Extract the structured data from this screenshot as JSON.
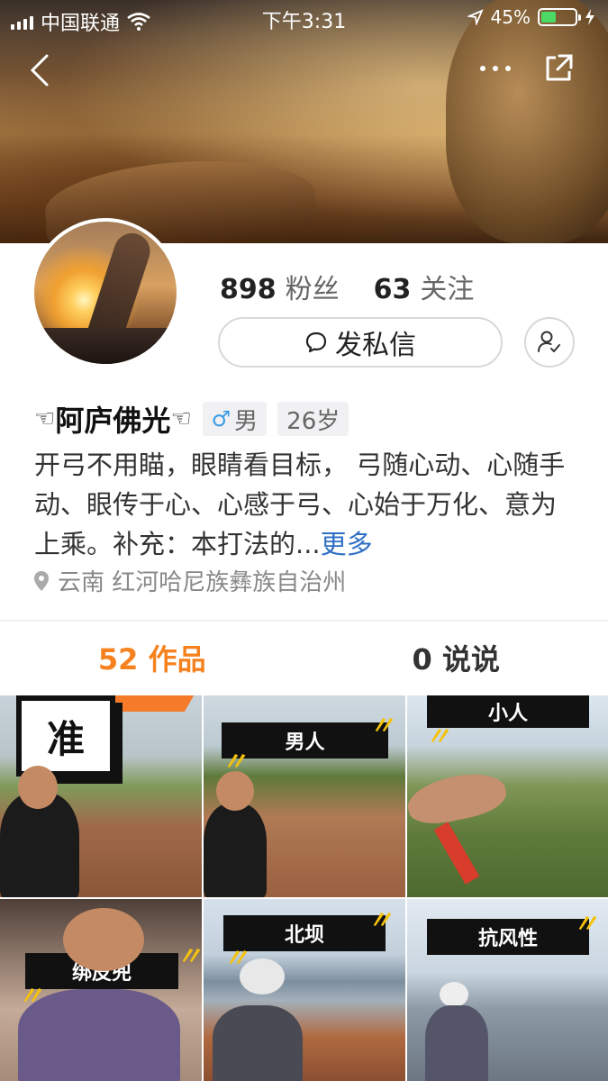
{
  "status_bar": {
    "carrier": "中国联通",
    "time": "下午3:31",
    "battery_percent": "45%",
    "battery_level": 0.45
  },
  "nav": {
    "back_icon": "chevron-left-icon",
    "more_icon": "more-dots-icon",
    "share_icon": "share-external-icon"
  },
  "profile": {
    "fans_count": "898",
    "fans_label": "粉丝",
    "following_count": "63",
    "following_label": "关注",
    "message_button": "发私信",
    "name_prefix": "☜",
    "name": "阿庐佛光",
    "name_suffix": "☜",
    "gender_symbol": "♂",
    "gender": "男",
    "age": "26岁",
    "bio": "开弓不用瞄，眼睛看目标， 弓随心动、心随手动、眼传于心、心感于弓、心始于万化、意为上乘。补充：本打法的...",
    "bio_more": "更多",
    "location": "云南 红河哈尼族彝族自治州"
  },
  "tabs": [
    {
      "label": "52 作品",
      "active": true
    },
    {
      "label": "0 说说",
      "active": false
    }
  ],
  "videos": [
    {
      "label": "准"
    },
    {
      "label": "男人"
    },
    {
      "label": "小人"
    },
    {
      "label": "绑皮兜"
    },
    {
      "label": "北坝"
    },
    {
      "label": "抗风性"
    }
  ],
  "colors": {
    "accent": "#f5821f",
    "link": "#2e6fc4",
    "gender": "#3b9be6"
  }
}
